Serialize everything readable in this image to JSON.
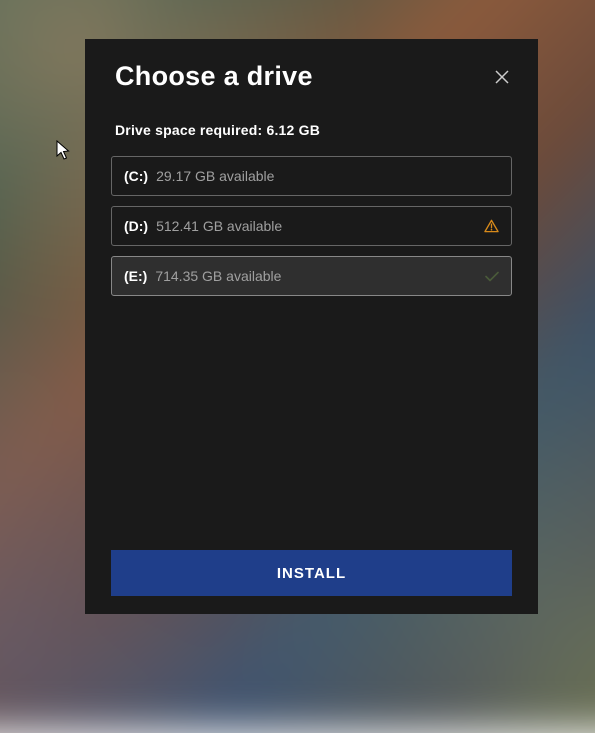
{
  "title": "Choose a drive",
  "space_required_label": "Drive space required: 6.12 GB",
  "drives": [
    {
      "label": "(C:)",
      "available": "29.17 GB available",
      "status": "none",
      "selected": false
    },
    {
      "label": "(D:)",
      "available": "512.41 GB available",
      "status": "warning",
      "selected": false
    },
    {
      "label": "(E:)",
      "available": "714.35 GB available",
      "status": "selected",
      "selected": true
    }
  ],
  "install_button_label": "INSTALL"
}
